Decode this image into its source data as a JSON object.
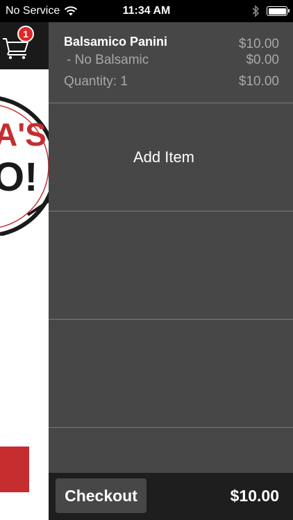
{
  "status_bar": {
    "carrier": "No Service",
    "time": "11:34 AM",
    "wifi_icon": "wifi-icon",
    "bluetooth_icon": "bluetooth-icon",
    "battery_icon": "battery-icon"
  },
  "background": {
    "cart_icon": "shopping-cart-icon",
    "cart_count": "1",
    "logo_text_partial": "A'S",
    "logo_text_partial_2": "O!",
    "accent_red": "#c52d2f"
  },
  "cart": {
    "item": {
      "name": "Balsamico Panini",
      "price": "$10.00",
      "modifier": "- No Balsamic",
      "modifier_price": "$0.00",
      "quantity_label": "Quantity: 1",
      "line_total": "$10.00"
    },
    "add_item_label": "Add Item"
  },
  "footer": {
    "checkout_label": "Checkout",
    "total": "$10.00"
  }
}
